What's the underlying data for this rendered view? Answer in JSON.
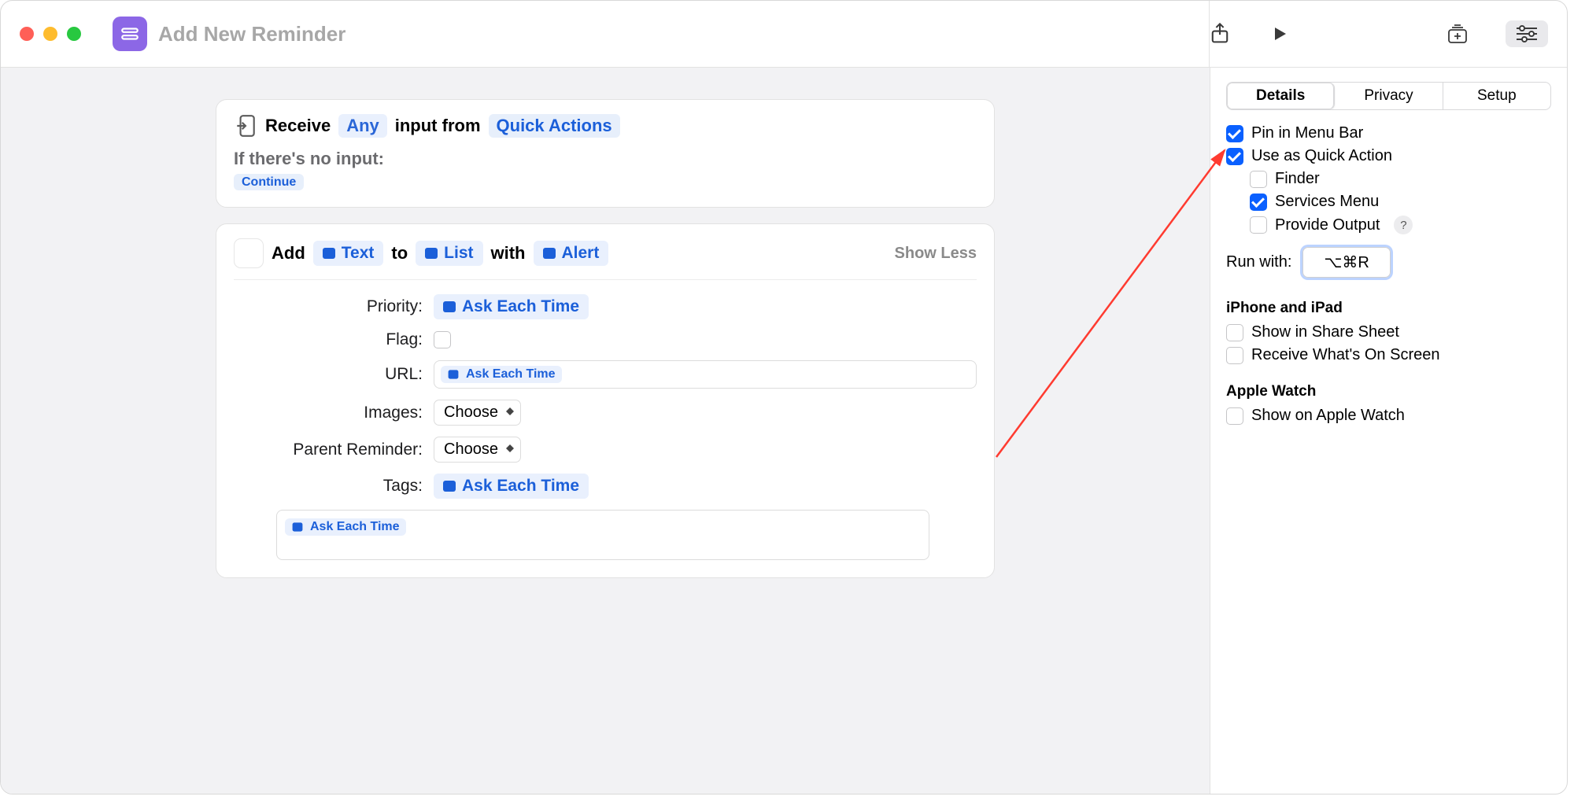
{
  "window": {
    "title": "Add New Reminder"
  },
  "canvas": {
    "receive": {
      "word_receive": "Receive",
      "any": "Any",
      "input_from": "input from",
      "source": "Quick Actions",
      "no_input_label": "If there's no input:",
      "continue": "Continue"
    },
    "addAction": {
      "word_add": "Add",
      "text_token": "Text",
      "word_to": "to",
      "list_token": "List",
      "word_with": "with",
      "alert_token": "Alert",
      "show_less": "Show Less",
      "fields": {
        "priority_label": "Priority:",
        "priority_value": "Ask Each Time",
        "flag_label": "Flag:",
        "url_label": "URL:",
        "url_value": "Ask Each Time",
        "images_label": "Images:",
        "images_value": "Choose",
        "parent_label": "Parent Reminder:",
        "parent_value": "Choose",
        "tags_label": "Tags:",
        "tags_value": "Ask Each Time",
        "notes_value": "Ask Each Time"
      }
    }
  },
  "sidebar": {
    "tabs": {
      "details": "Details",
      "privacy": "Privacy",
      "setup": "Setup"
    },
    "pin_menu_bar": "Pin in Menu Bar",
    "use_quick_action": "Use as Quick Action",
    "finder": "Finder",
    "services_menu": "Services Menu",
    "provide_output": "Provide Output",
    "run_with_label": "Run with:",
    "run_with_value": "⌥⌘R",
    "iphone_ipad_header": "iPhone and iPad",
    "show_share_sheet": "Show in Share Sheet",
    "receive_screen": "Receive What's On Screen",
    "apple_watch_header": "Apple Watch",
    "show_apple_watch": "Show on Apple Watch"
  }
}
